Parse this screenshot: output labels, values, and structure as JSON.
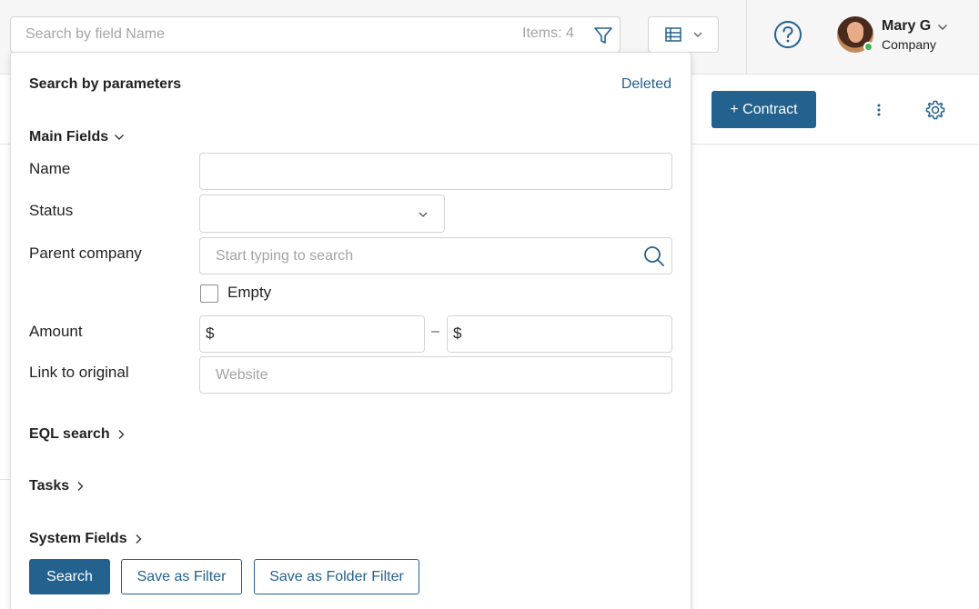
{
  "header": {
    "search_placeholder": "Search by field Name",
    "items_count": "Items: 4",
    "user": {
      "name": "Mary G",
      "company": "Company",
      "status": "online"
    }
  },
  "toolbar": {
    "contract_button": "+ Contract"
  },
  "filter_panel": {
    "title": "Search by parameters",
    "deleted_link": "Deleted",
    "main_fields_label": "Main Fields",
    "fields": {
      "name_label": "Name",
      "name_value": "",
      "status_label": "Status",
      "status_value": "",
      "parent_company_label": "Parent company",
      "parent_company_placeholder": "Start typing to search",
      "empty_label": "Empty",
      "empty_checked": false,
      "amount_label": "Amount",
      "currency_symbol": "$",
      "amount_separator": "–",
      "link_label": "Link to original",
      "link_placeholder": "Website"
    },
    "sections": [
      "EQL search",
      "Tasks",
      "System Fields"
    ],
    "buttons": {
      "search": "Search",
      "save_filter": "Save as Filter",
      "save_folder_filter": "Save as Folder Filter"
    }
  },
  "colors": {
    "accent": "#23618f",
    "online": "#3dbb4c"
  }
}
